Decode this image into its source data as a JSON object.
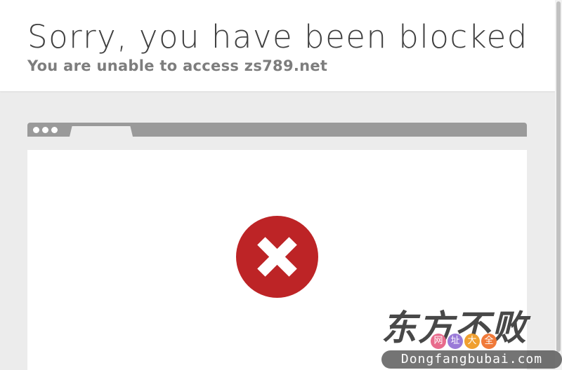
{
  "page": {
    "title": "Sorry, you have been blocked",
    "subtitle": "You are unable to access zs789.net"
  },
  "illustration": {
    "icon": "error-x-icon",
    "accent_color": "#bd2426"
  },
  "watermark": {
    "brand": "东方不败",
    "sub_chars": [
      "网",
      "址",
      "大",
      "全"
    ],
    "sub_colors": [
      "#e86b8c",
      "#9a7ad8",
      "#f0a030",
      "#f07a3a"
    ],
    "url": "Dongfangbubai.com"
  }
}
